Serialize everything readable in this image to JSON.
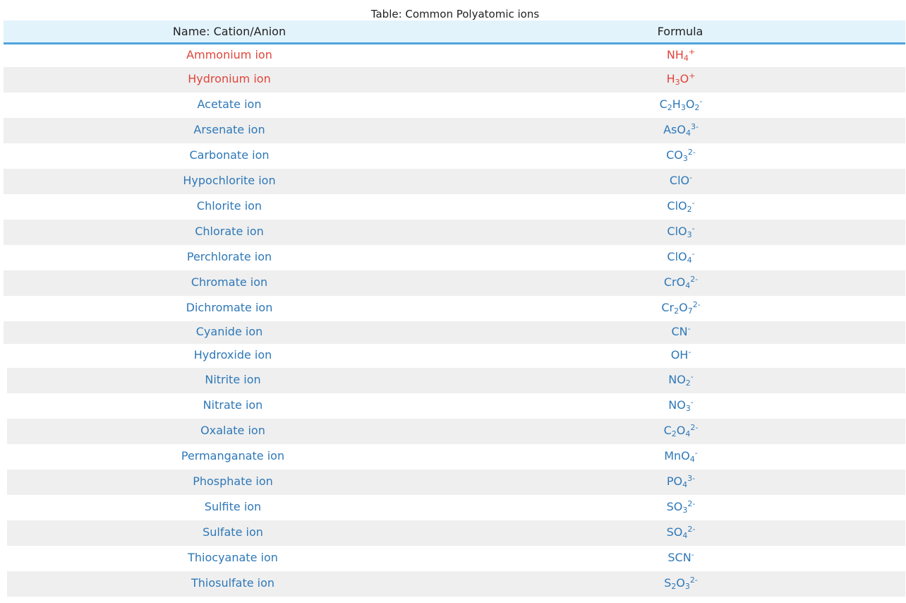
{
  "caption": "Table: Common Polyatomic ions",
  "headers": {
    "name": "Name: Cation/Anion",
    "formula": "Formula"
  },
  "colors": {
    "header_bg": "#e3f3fc",
    "header_rule": "#4fa3dc",
    "cation_text": "#e0453a",
    "anion_text": "#2e78b8",
    "stripe": "#efefef"
  },
  "rows": [
    {
      "name": "Ammonium ion",
      "kind": "cation",
      "formula": [
        {
          "t": "NH"
        },
        {
          "sub": "4"
        },
        {
          "sup": "+"
        }
      ]
    },
    {
      "name": "Hydronium ion",
      "kind": "cation",
      "formula": [
        {
          "t": "H"
        },
        {
          "sub": "3"
        },
        {
          "t": "O"
        },
        {
          "sup": "+"
        }
      ]
    },
    {
      "name": "Acetate ion",
      "kind": "anion",
      "formula": [
        {
          "t": "C"
        },
        {
          "sub": "2"
        },
        {
          "t": "H"
        },
        {
          "sub": "3"
        },
        {
          "t": "O"
        },
        {
          "sub": "2"
        },
        {
          "sup": "-"
        }
      ]
    },
    {
      "name": "Arsenate ion",
      "kind": "anion",
      "formula": [
        {
          "t": "AsO"
        },
        {
          "sub": "4"
        },
        {
          "sup": "3-"
        }
      ]
    },
    {
      "name": "Carbonate ion",
      "kind": "anion",
      "formula": [
        {
          "t": "CO"
        },
        {
          "sub": "3"
        },
        {
          "sup": "2-"
        }
      ]
    },
    {
      "name": "Hypochlorite ion",
      "kind": "anion",
      "formula": [
        {
          "t": "ClO"
        },
        {
          "sup": "-"
        }
      ]
    },
    {
      "name": "Chlorite ion",
      "kind": "anion",
      "formula": [
        {
          "t": "ClO"
        },
        {
          "sub": "2"
        },
        {
          "sup": "-"
        }
      ]
    },
    {
      "name": "Chlorate ion",
      "kind": "anion",
      "formula": [
        {
          "t": "ClO"
        },
        {
          "sub": "3"
        },
        {
          "sup": "-"
        }
      ]
    },
    {
      "name": "Perchlorate ion",
      "kind": "anion",
      "formula": [
        {
          "t": "ClO"
        },
        {
          "sub": "4"
        },
        {
          "sup": "-"
        }
      ]
    },
    {
      "name": "Chromate ion",
      "kind": "anion",
      "formula": [
        {
          "t": "CrO"
        },
        {
          "sub": "4"
        },
        {
          "sup": "2-"
        }
      ]
    },
    {
      "name": "Dichromate ion",
      "kind": "anion",
      "formula": [
        {
          "t": "Cr"
        },
        {
          "sub": "2"
        },
        {
          "t": "O"
        },
        {
          "sub": "7"
        },
        {
          "sup": "2-"
        }
      ]
    },
    {
      "name": "Cyanide ion",
      "kind": "anion",
      "formula": [
        {
          "t": "CN"
        },
        {
          "sup": "-"
        }
      ]
    },
    {
      "name": "Hydroxide ion",
      "kind": "anion",
      "formula": [
        {
          "t": "OH"
        },
        {
          "sup": "-"
        }
      ]
    },
    {
      "name": "Nitrite ion",
      "kind": "anion",
      "formula": [
        {
          "t": "NO"
        },
        {
          "sub": "2"
        },
        {
          "sup": "-"
        }
      ]
    },
    {
      "name": "Nitrate ion",
      "kind": "anion",
      "formula": [
        {
          "t": "NO"
        },
        {
          "sub": "3"
        },
        {
          "sup": "-"
        }
      ]
    },
    {
      "name": "Oxalate ion",
      "kind": "anion",
      "formula": [
        {
          "t": "C"
        },
        {
          "sub": "2"
        },
        {
          "t": "O"
        },
        {
          "sub": "4"
        },
        {
          "sup": "2-"
        }
      ]
    },
    {
      "name": "Permanganate ion",
      "kind": "anion",
      "formula": [
        {
          "t": "MnO"
        },
        {
          "sub": "4"
        },
        {
          "sup": "-"
        }
      ]
    },
    {
      "name": "Phosphate ion",
      "kind": "anion",
      "formula": [
        {
          "t": "PO"
        },
        {
          "sub": "4"
        },
        {
          "sup": "3-"
        }
      ]
    },
    {
      "name": "Sulfite ion",
      "kind": "anion",
      "formula": [
        {
          "t": "SO"
        },
        {
          "sub": "3"
        },
        {
          "sup": "2-"
        }
      ]
    },
    {
      "name": "Sulfate ion",
      "kind": "anion",
      "formula": [
        {
          "t": "SO"
        },
        {
          "sub": "4"
        },
        {
          "sup": "2-"
        }
      ]
    },
    {
      "name": "Thiocyanate ion",
      "kind": "anion",
      "formula": [
        {
          "t": "SCN"
        },
        {
          "sup": "-"
        }
      ]
    },
    {
      "name": "Thiosulfate ion",
      "kind": "anion",
      "formula": [
        {
          "t": "S"
        },
        {
          "sub": "2"
        },
        {
          "t": "O"
        },
        {
          "sub": "3"
        },
        {
          "sup": "2-"
        }
      ]
    }
  ]
}
